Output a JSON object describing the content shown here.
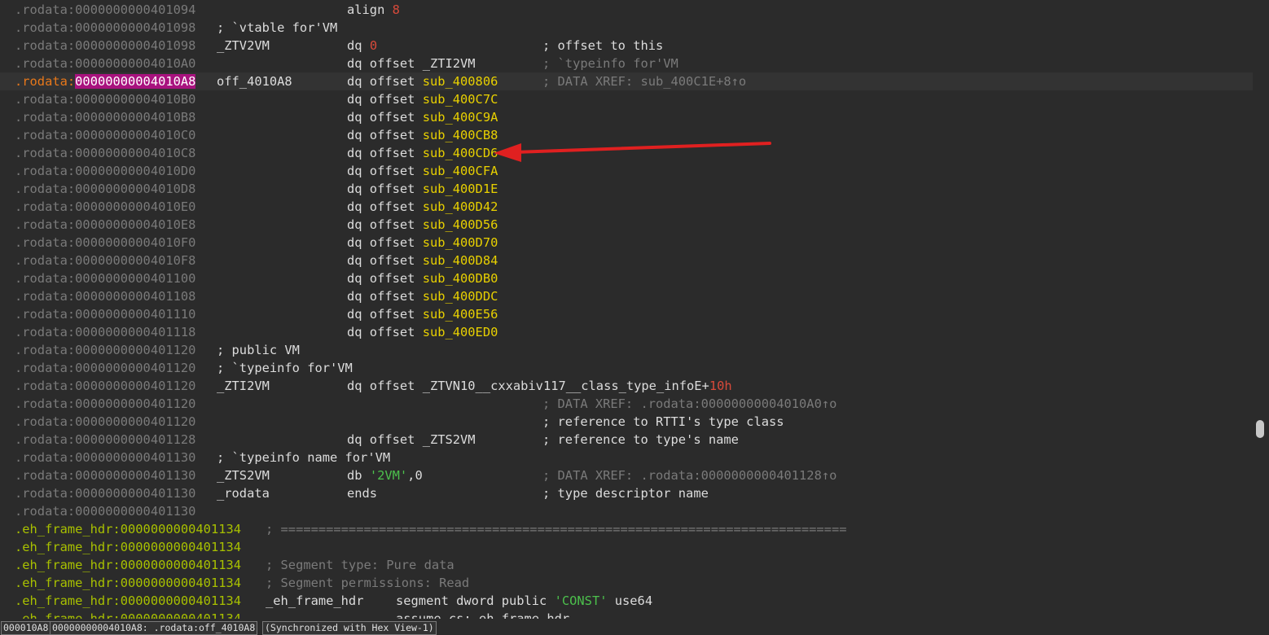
{
  "lines": [
    {
      "seg": ".rodata",
      "addr": "0000000000401094",
      "op": "align",
      "arg": "8"
    },
    {
      "seg": ".rodata",
      "addr": "0000000000401098",
      "hdr": "; `vtable for'VM"
    },
    {
      "seg": ".rodata",
      "addr": "0000000000401098",
      "label": "_ZTV2VM",
      "op": "dq",
      "arg": "0",
      "comment": "; offset to this"
    },
    {
      "seg": ".rodata",
      "addr": "00000000004010A0",
      "op": "dq offset",
      "arg": "_ZTI2VM",
      "comment": "; `typeinfo for'VM"
    },
    {
      "seg": ".rodata",
      "addr": "00000000004010A8",
      "label": "off_4010A8",
      "op": "dq offset",
      "arg": "sub_400806",
      "comment": "; DATA XREF: sub_400C1E+8↑o",
      "current": true
    },
    {
      "seg": ".rodata",
      "addr": "00000000004010B0",
      "op": "dq offset",
      "arg": "sub_400C7C"
    },
    {
      "seg": ".rodata",
      "addr": "00000000004010B8",
      "op": "dq offset",
      "arg": "sub_400C9A"
    },
    {
      "seg": ".rodata",
      "addr": "00000000004010C0",
      "op": "dq offset",
      "arg": "sub_400CB8"
    },
    {
      "seg": ".rodata",
      "addr": "00000000004010C8",
      "op": "dq offset",
      "arg": "sub_400CD6"
    },
    {
      "seg": ".rodata",
      "addr": "00000000004010D0",
      "op": "dq offset",
      "arg": "sub_400CFA"
    },
    {
      "seg": ".rodata",
      "addr": "00000000004010D8",
      "op": "dq offset",
      "arg": "sub_400D1E"
    },
    {
      "seg": ".rodata",
      "addr": "00000000004010E0",
      "op": "dq offset",
      "arg": "sub_400D42"
    },
    {
      "seg": ".rodata",
      "addr": "00000000004010E8",
      "op": "dq offset",
      "arg": "sub_400D56"
    },
    {
      "seg": ".rodata",
      "addr": "00000000004010F0",
      "op": "dq offset",
      "arg": "sub_400D70"
    },
    {
      "seg": ".rodata",
      "addr": "00000000004010F8",
      "op": "dq offset",
      "arg": "sub_400D84"
    },
    {
      "seg": ".rodata",
      "addr": "0000000000401100",
      "op": "dq offset",
      "arg": "sub_400DB0"
    },
    {
      "seg": ".rodata",
      "addr": "0000000000401108",
      "op": "dq offset",
      "arg": "sub_400DDC"
    },
    {
      "seg": ".rodata",
      "addr": "0000000000401110",
      "op": "dq offset",
      "arg": "sub_400E56"
    },
    {
      "seg": ".rodata",
      "addr": "0000000000401118",
      "op": "dq offset",
      "arg": "sub_400ED0"
    },
    {
      "seg": ".rodata",
      "addr": "0000000000401120",
      "hdr": "; public VM"
    },
    {
      "seg": ".rodata",
      "addr": "0000000000401120",
      "hdr": "; `typeinfo for'VM"
    },
    {
      "seg": ".rodata",
      "addr": "0000000000401120",
      "label": "_ZTI2VM",
      "op": "dq offset",
      "arg": "_ZTVN10__cxxabiv117__class_type_infoE",
      "plus": "+",
      "arg2": "10h"
    },
    {
      "seg": ".rodata",
      "addr": "0000000000401120",
      "dimcomment": "; DATA XREF: .rodata:00000000004010A0↑o"
    },
    {
      "seg": ".rodata",
      "addr": "0000000000401120",
      "comment": "; reference to RTTI's type class"
    },
    {
      "seg": ".rodata",
      "addr": "0000000000401128",
      "op": "dq offset",
      "arg": "_ZTS2VM",
      "plainarg": true,
      "comment": "; reference to type's name"
    },
    {
      "seg": ".rodata",
      "addr": "0000000000401130",
      "hdr": "; `typeinfo name for'VM"
    },
    {
      "seg": ".rodata",
      "addr": "0000000000401130",
      "label": "_ZTS2VM",
      "op": "db",
      "str": "'2VM'",
      "tail": ",0",
      "dimcomment": "; DATA XREF: .rodata:0000000000401128↑o"
    },
    {
      "seg": ".rodata",
      "addr": "0000000000401130",
      "label": "_rodata",
      "op": "ends",
      "comment": "; type descriptor name"
    },
    {
      "seg": ".rodata",
      "addr": "0000000000401130"
    },
    {
      "seg": ".eh_frame_hdr",
      "addr": "0000000000401134",
      "sep": "; ==========================================================================="
    },
    {
      "seg": ".eh_frame_hdr",
      "addr": "0000000000401134"
    },
    {
      "seg": ".eh_frame_hdr",
      "addr": "0000000000401134",
      "sep": "; Segment type: Pure data"
    },
    {
      "seg": ".eh_frame_hdr",
      "addr": "0000000000401134",
      "sep": "; Segment permissions: Read"
    },
    {
      "seg": ".eh_frame_hdr",
      "addr": "0000000000401134",
      "label": "_eh_frame_hdr",
      "op": "segment dword public",
      "str": "'CONST'",
      "tail": " use64"
    },
    {
      "seg": ".eh_frame_hdr",
      "addr": "0000000000401134",
      "op": "assume cs:_eh_frame_hdr"
    }
  ],
  "status": {
    "cell1": "000010A8",
    "cell2": "00000000004010A8: .rodata:off_4010A8",
    "cell3": "(Synchronized with Hex View-1)"
  },
  "colors": {
    "background": "#2b2b2b",
    "symbol": "#e8d000",
    "number": "#d84a3a",
    "string": "#4cc04c",
    "segment_eh": "#a8c000",
    "cursor_addr_bg": "#a8127e",
    "annotation_arrow": "#e02020"
  }
}
